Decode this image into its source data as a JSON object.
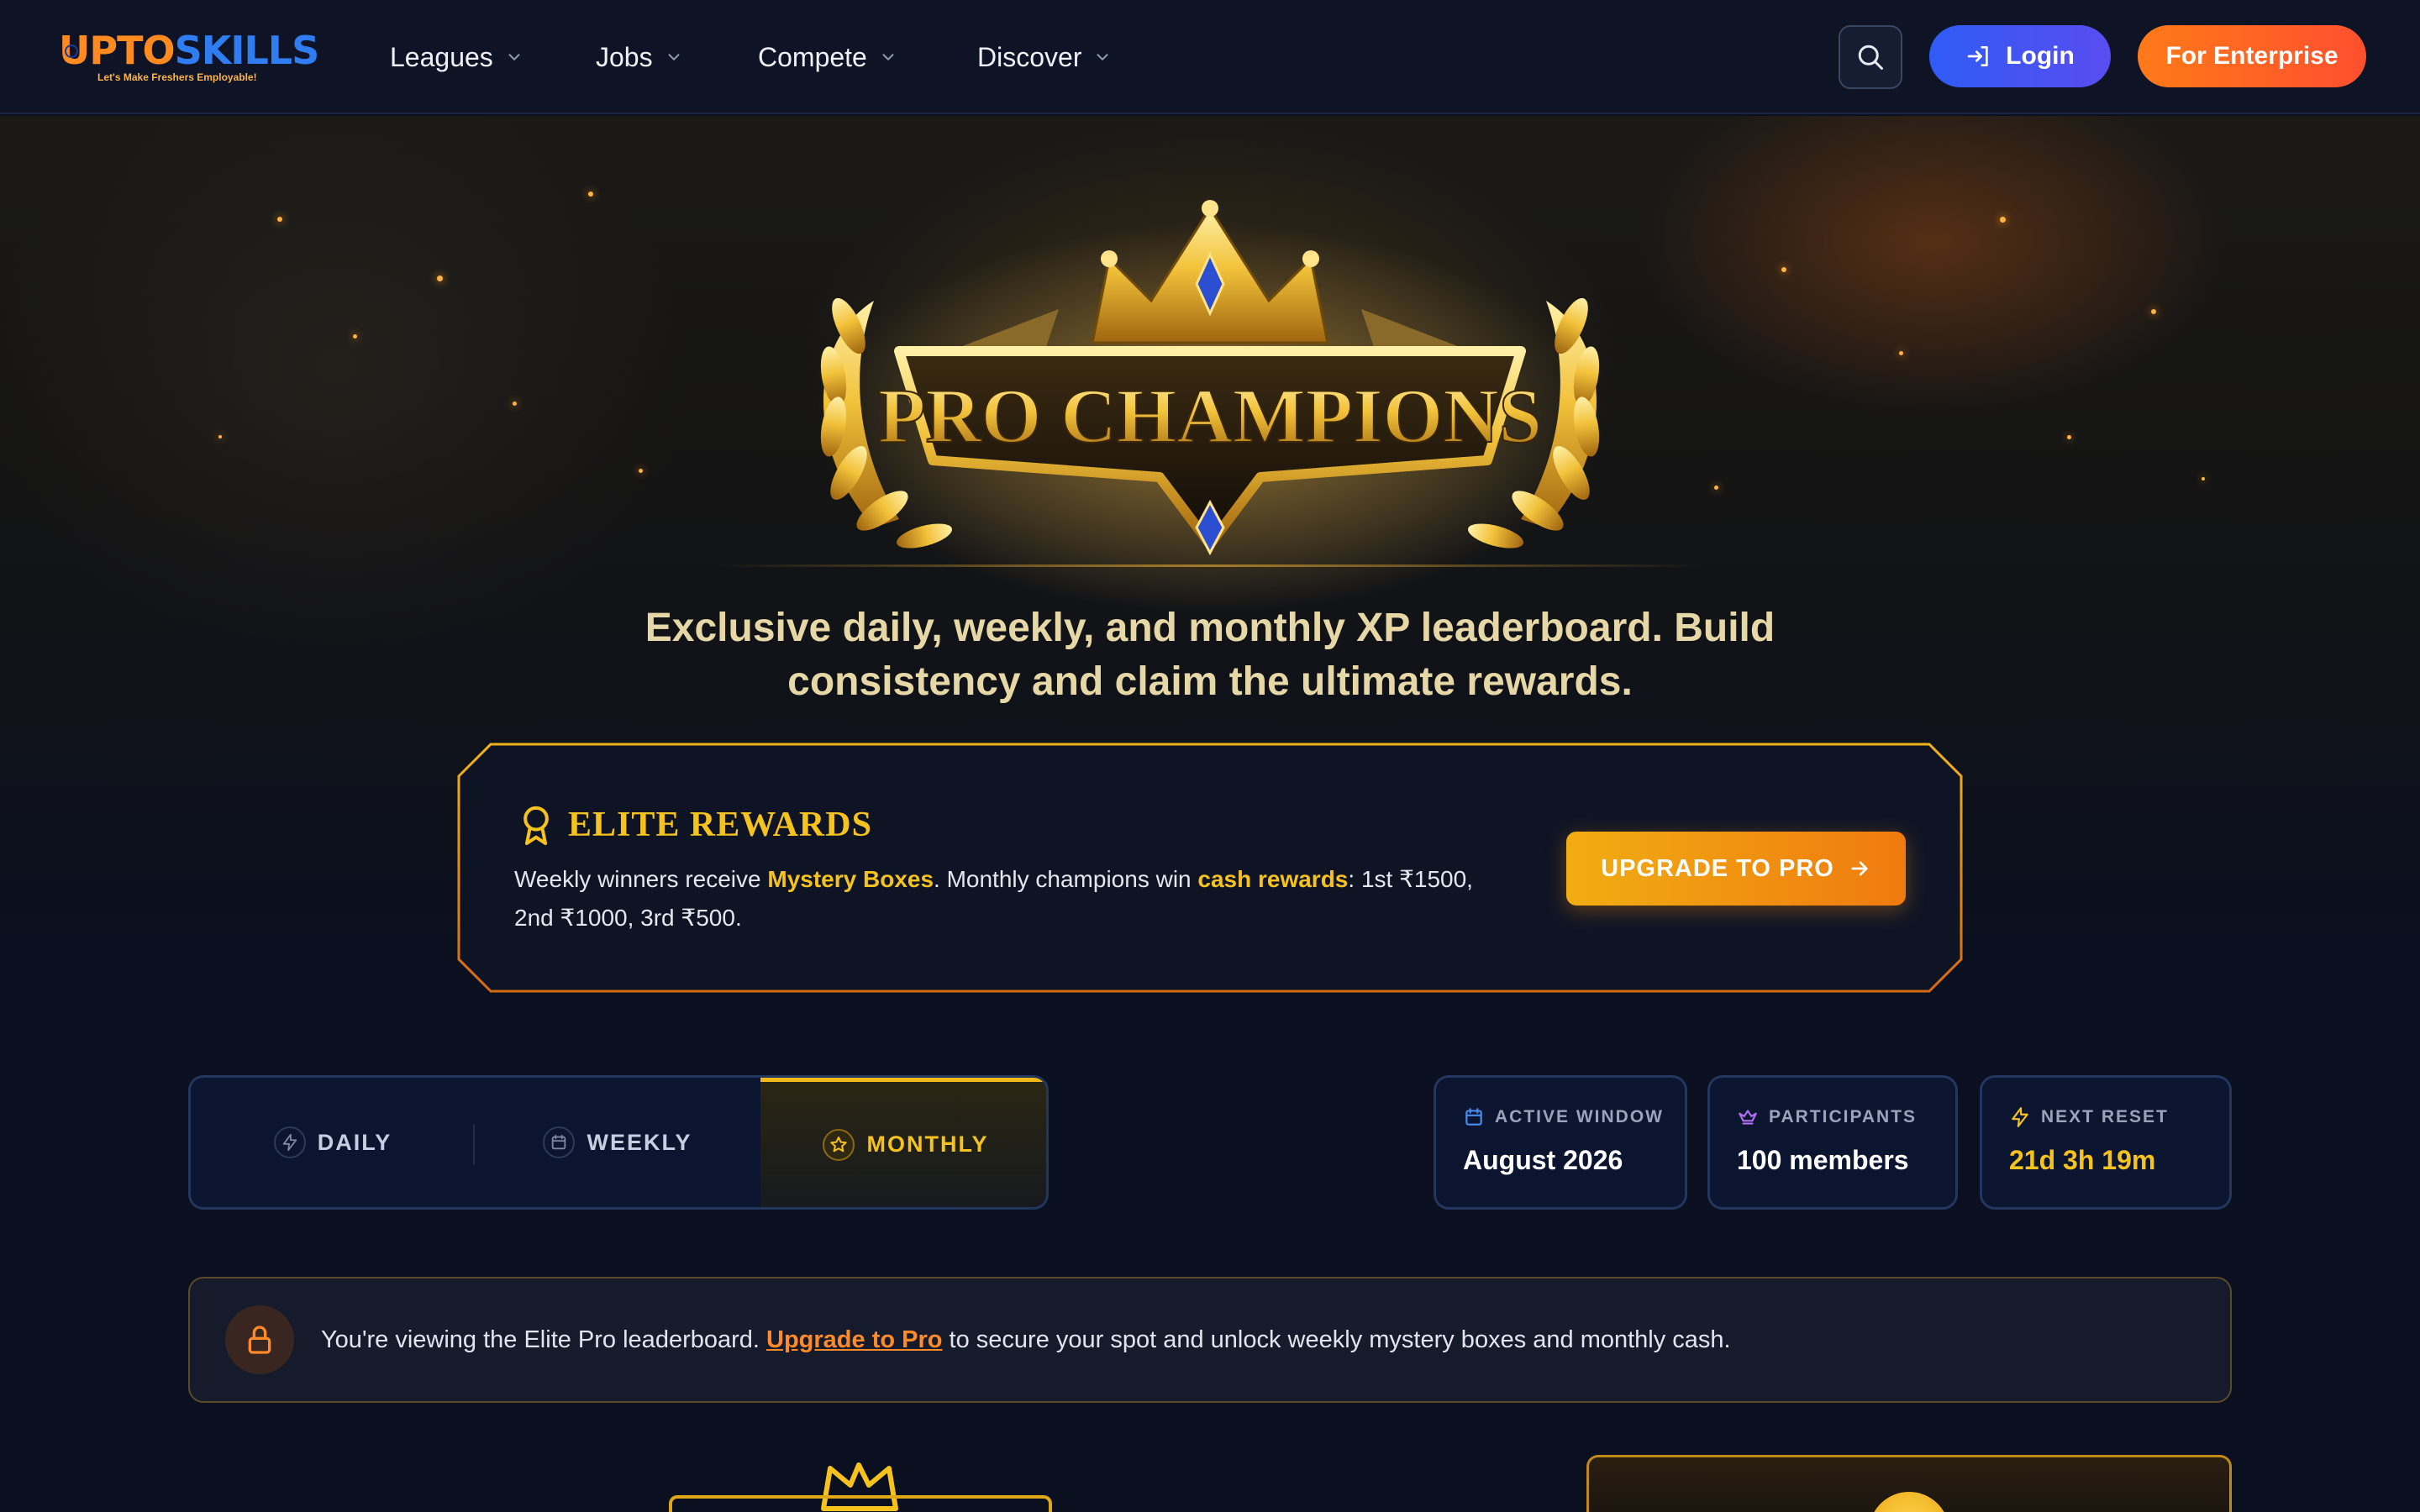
{
  "nav": {
    "logo_text_a": "UPTO",
    "logo_text_b": "SKILLS",
    "logo_tagline": "Let's Make Freshers Employable!",
    "items": [
      {
        "label": "Leagues"
      },
      {
        "label": "Jobs"
      },
      {
        "label": "Compete"
      },
      {
        "label": "Discover"
      }
    ],
    "login_label": "Login",
    "enterprise_label": "For Enterprise"
  },
  "hero": {
    "emblem_title": "PRO CHAMPIONS",
    "tagline": "Exclusive daily, weekly, and monthly XP leaderboard. Build consistency and claim the ultimate rewards."
  },
  "rewards": {
    "title": "ELITE REWARDS",
    "text_1": "Weekly winners receive ",
    "highlight_1": "Mystery Boxes",
    "text_2": ". Monthly champions win ",
    "highlight_2": "cash rewards",
    "text_3": ": 1st ₹1500, 2nd ₹1000, 3rd ₹500.",
    "button_label": "UPGRADE TO PRO"
  },
  "tabs": [
    {
      "label": "DAILY",
      "icon": "bolt-icon",
      "active": false
    },
    {
      "label": "WEEKLY",
      "icon": "calendar-icon",
      "active": false
    },
    {
      "label": "MONTHLY",
      "icon": "star-icon",
      "active": true
    }
  ],
  "stats": {
    "active_window_label": "ACTIVE WINDOW",
    "active_window_value": "August 2026",
    "participants_label": "PARTICIPANTS",
    "participants_value": "100 members",
    "next_reset_label": "NEXT RESET",
    "next_reset_value": "21d 3h 19m"
  },
  "notice": {
    "text_before": "You're viewing the Elite Pro leaderboard. ",
    "link_label": "Upgrade to Pro",
    "text_after": " to secure your spot and unlock weekly mystery boxes and monthly cash."
  },
  "colors": {
    "gold": "#f6c31e",
    "accent_orange": "#ff7a18",
    "login_blue": "#2f5cf5",
    "bg": "#0b1020"
  }
}
